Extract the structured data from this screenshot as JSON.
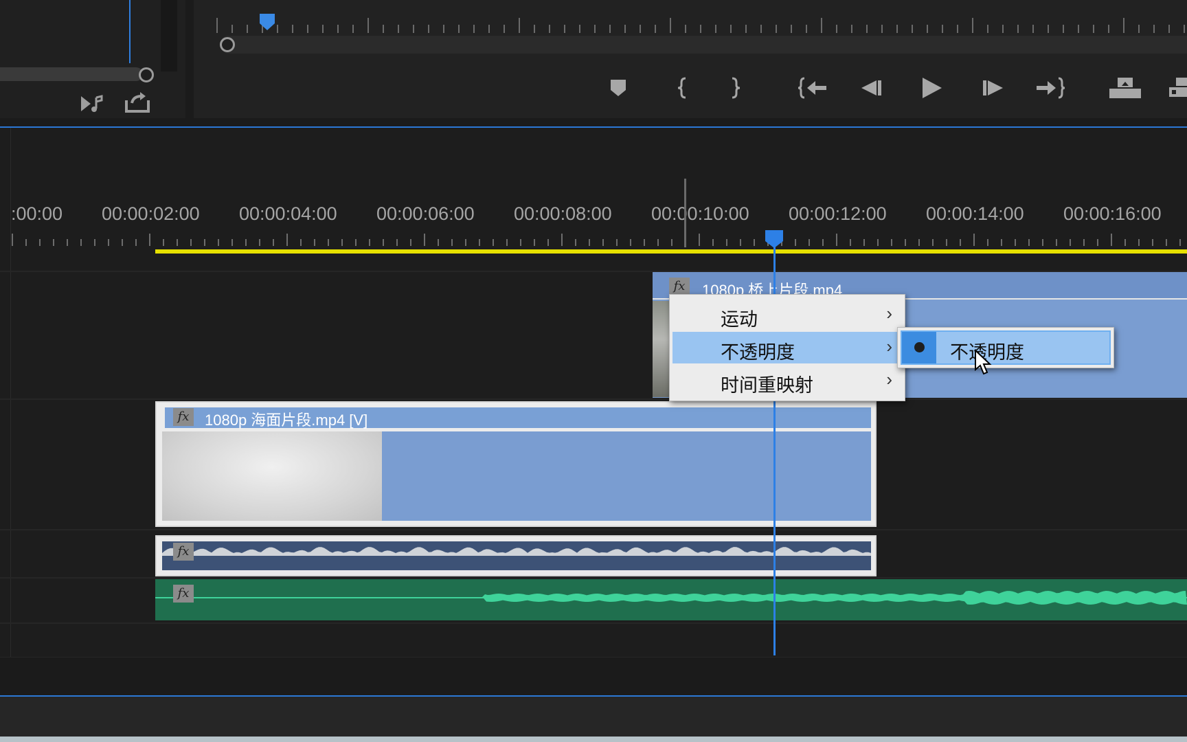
{
  "source_monitor": {
    "buttons": [
      {
        "name": "insert-audio-button",
        "glyph": "▶♪"
      },
      {
        "name": "export-frame-button",
        "glyph": "⇪"
      }
    ]
  },
  "program_monitor": {
    "transport_icons": [
      "marker-icon",
      "mark-in-icon",
      "mark-out-icon",
      "go-to-in-icon",
      "step-back-icon",
      "play-icon",
      "step-forward-icon",
      "go-to-out-icon",
      "lift-icon",
      "extract-icon"
    ]
  },
  "timeline": {
    "timecodes": [
      ":00:00",
      "00:00:02:00",
      "00:00:04:00",
      "00:00:06:00",
      "00:00:08:00",
      "00:00:10:00",
      "00:00:12:00",
      "00:00:14:00",
      "00:00:16:00"
    ],
    "clips": {
      "v2": {
        "fx": "fx",
        "name": "1080p 桥上片段.mp4"
      },
      "v1": {
        "fx": "fx",
        "name": "1080p 海面片段.mp4 [V]"
      },
      "a1": {
        "fx": "fx"
      },
      "a2": {
        "fx": "fx"
      }
    }
  },
  "context_menu": {
    "items": [
      {
        "label": "运动",
        "arrow": "›"
      },
      {
        "label": "不透明度",
        "arrow": "›"
      },
      {
        "label": "时间重映射",
        "arrow": "›"
      }
    ],
    "submenu": {
      "label": "不透明度"
    }
  },
  "colors": {
    "accent_blue": "#2d80e6",
    "work_area": "#e6e000",
    "video_clip": "#7a9dd1",
    "audio_clip_a1": "#3d5276",
    "audio_clip_a2": "#1f6f4e",
    "menu_highlight": "#99c4f1"
  }
}
